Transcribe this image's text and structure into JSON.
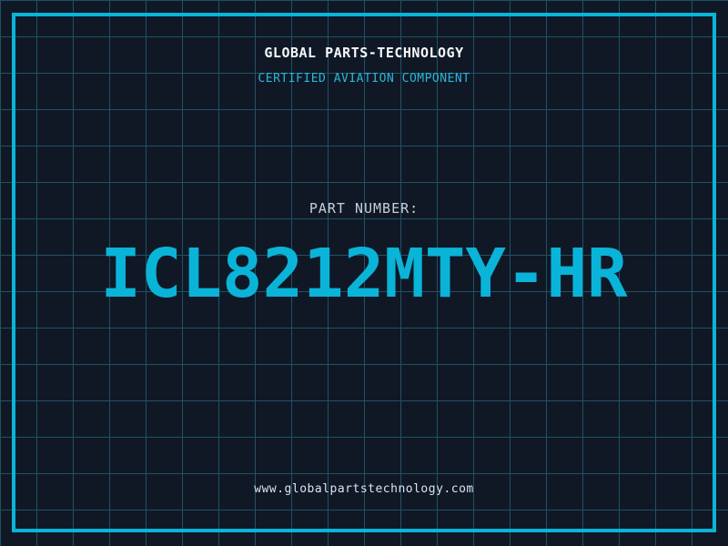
{
  "page": {
    "background_color": "#101826",
    "grid_color": "#1e5265",
    "accent_color": "#0ab4d8",
    "grid_cell_size_px": 40
  },
  "header": {
    "company_name": "GLOBAL PARTS-TECHNOLOGY",
    "tagline": "CERTIFIED AVIATION COMPONENT"
  },
  "part": {
    "label": "PART NUMBER:",
    "number": "ICL8212MTY-HR"
  },
  "footer": {
    "website": "www.globalpartstechnology.com"
  }
}
